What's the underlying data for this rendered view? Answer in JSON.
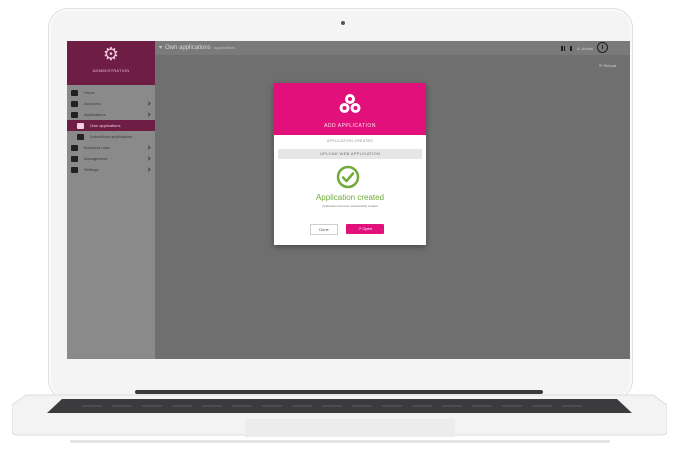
{
  "app": {
    "brand_label": "ADMINISTRATION",
    "breadcrumb": {
      "title": "Own applications",
      "subtitle": "Applications"
    },
    "user_label": "A. Admin",
    "refresh_label": "⟳ Reload"
  },
  "sidebar": {
    "items": [
      {
        "label": "Home",
        "icon": "home-icon"
      },
      {
        "label": "Accounts",
        "icon": "accounts-icon"
      },
      {
        "label": "Applications",
        "icon": "applications-icon"
      },
      {
        "label": "Own applications",
        "icon": "own-applications-icon",
        "active": true
      },
      {
        "label": "Subscribed applications",
        "icon": "subscribed-icon"
      },
      {
        "label": "Business rules",
        "icon": "business-rules-icon"
      },
      {
        "label": "Management",
        "icon": "management-icon"
      },
      {
        "label": "Settings",
        "icon": "settings-icon"
      }
    ]
  },
  "modal": {
    "title": "ADD APPLICATION",
    "step1": "APPLICATION CREATED",
    "step2": "UPLOAD WEB APPLICATION",
    "success_title": "Application created",
    "success_sub": "Application has been successfully created",
    "done_label": "Done",
    "open_label": "↗ Open"
  },
  "colors": {
    "accent": "#e2107b",
    "brand": "#6e1d45",
    "success": "#6fab3a"
  }
}
